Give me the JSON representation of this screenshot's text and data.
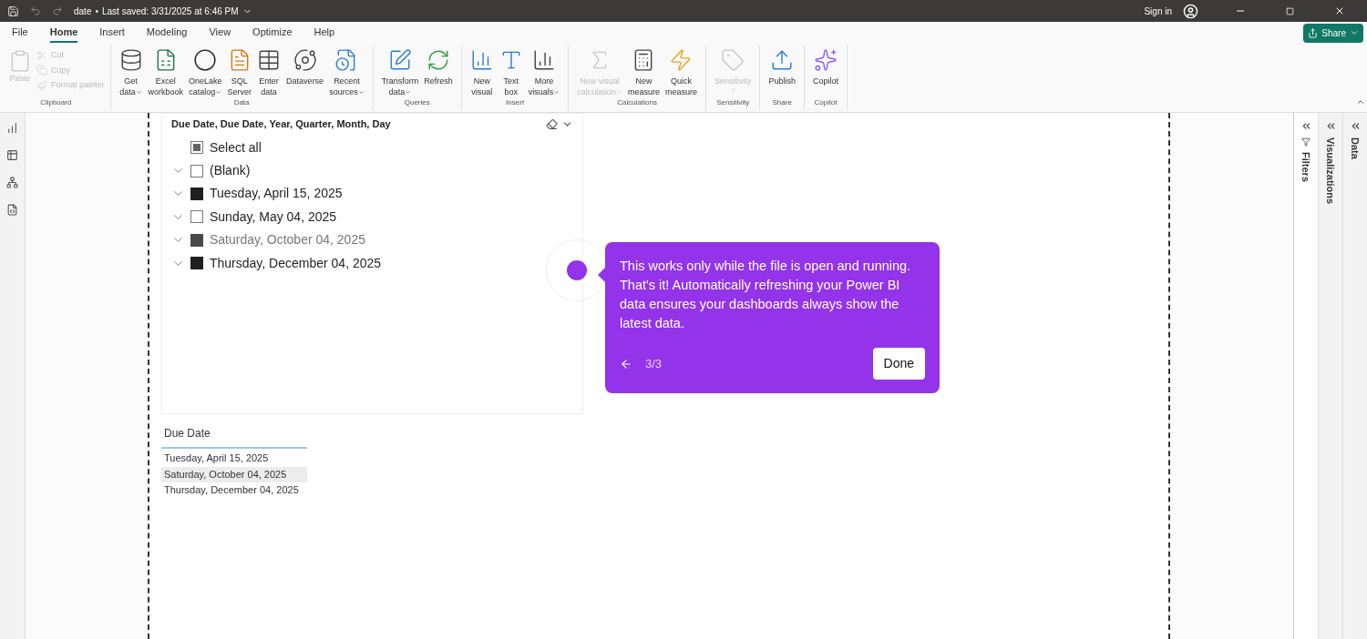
{
  "title_bar": {
    "file_name": "date",
    "separator": "•",
    "save_status": "Last saved: 3/31/2025 at 6:46 PM",
    "sign_in": "Sign in"
  },
  "menu_tabs": [
    {
      "label": "File",
      "selected": false
    },
    {
      "label": "Home",
      "selected": true
    },
    {
      "label": "Insert",
      "selected": false
    },
    {
      "label": "Modeling",
      "selected": false
    },
    {
      "label": "View",
      "selected": false
    },
    {
      "label": "Optimize",
      "selected": false
    },
    {
      "label": "Help",
      "selected": false
    }
  ],
  "share_button": "Share",
  "ribbon_groups": [
    {
      "label": "Clipboard",
      "kind": "clipboard",
      "buttons": [
        {
          "lines": [
            "Paste"
          ],
          "disabled": true
        },
        {
          "lines": [
            "Cut"
          ],
          "disabled": true
        },
        {
          "lines": [
            "Copy"
          ],
          "disabled": true
        },
        {
          "lines": [
            "Format painter"
          ],
          "disabled": true
        }
      ]
    },
    {
      "label": "Data",
      "kind": "large",
      "buttons": [
        {
          "lines": [
            "Get",
            "data"
          ],
          "disabled": false,
          "dropdown": true
        },
        {
          "lines": [
            "Excel",
            "workbook"
          ],
          "disabled": false,
          "dropdown": false
        },
        {
          "lines": [
            "OneLake",
            "catalog"
          ],
          "disabled": false,
          "dropdown": true
        },
        {
          "lines": [
            "SQL",
            "Server"
          ],
          "disabled": false,
          "dropdown": false
        },
        {
          "lines": [
            "Enter",
            "data"
          ],
          "disabled": false,
          "dropdown": false
        },
        {
          "lines": [
            "Dataverse"
          ],
          "disabled": false,
          "dropdown": false
        },
        {
          "lines": [
            "Recent",
            "sources"
          ],
          "disabled": false,
          "dropdown": true
        }
      ]
    },
    {
      "label": "Queries",
      "kind": "large",
      "buttons": [
        {
          "lines": [
            "Transform",
            "data"
          ],
          "disabled": false,
          "dropdown": true
        },
        {
          "lines": [
            "Refresh"
          ],
          "disabled": false,
          "dropdown": false
        }
      ]
    },
    {
      "label": "Insert",
      "kind": "large",
      "buttons": [
        {
          "lines": [
            "New",
            "visual"
          ],
          "disabled": false,
          "dropdown": false
        },
        {
          "lines": [
            "Text",
            "box"
          ],
          "disabled": false,
          "dropdown": false
        },
        {
          "lines": [
            "More",
            "visuals"
          ],
          "disabled": false,
          "dropdown": true
        }
      ]
    },
    {
      "label": "Calculations",
      "kind": "large",
      "buttons": [
        {
          "lines": [
            "New visual",
            "calculation"
          ],
          "disabled": true,
          "dropdown": true
        },
        {
          "lines": [
            "New",
            "measure"
          ],
          "disabled": false,
          "dropdown": false
        },
        {
          "lines": [
            "Quick",
            "measure"
          ],
          "disabled": false,
          "dropdown": false
        }
      ]
    },
    {
      "label": "Sensitivity",
      "kind": "large",
      "buttons": [
        {
          "lines": [
            "Sensitivity"
          ],
          "disabled": true,
          "dropdown": true
        }
      ]
    },
    {
      "label": "Share",
      "kind": "large",
      "buttons": [
        {
          "lines": [
            "Publish"
          ],
          "disabled": false,
          "dropdown": false
        }
      ]
    },
    {
      "label": "Copilot",
      "kind": "large",
      "buttons": [
        {
          "lines": [
            "Copilot"
          ],
          "disabled": false,
          "dropdown": false
        }
      ]
    }
  ],
  "side_panes": [
    {
      "label": "Filters",
      "selected": true
    },
    {
      "label": "Visualizations",
      "selected": false
    },
    {
      "label": "Data",
      "selected": false
    }
  ],
  "slicer": {
    "title": "Due Date, Due Date, Year, Quarter, Month, Day",
    "select_all": {
      "label": "Select all",
      "indeterminate": true
    },
    "items": [
      {
        "label": "(Blank)",
        "checked": false,
        "dimmed": false
      },
      {
        "label": "Tuesday, April 15, 2025",
        "checked": true,
        "dimmed": false
      },
      {
        "label": "Sunday, May 04, 2025",
        "checked": false,
        "dimmed": false
      },
      {
        "label": "Saturday, October 04, 2025",
        "checked": true,
        "dimmed": true
      },
      {
        "label": "Thursday, December 04, 2025",
        "checked": true,
        "dimmed": false
      }
    ]
  },
  "table": {
    "column": "Due Date",
    "rows": [
      {
        "value": "Tuesday, April 15, 2025",
        "selected": false
      },
      {
        "value": "Saturday, October 04, 2025",
        "selected": true
      },
      {
        "value": "Thursday, December 04, 2025",
        "selected": false
      }
    ]
  },
  "tour_tooltip": {
    "text": "This works only while the file is open and running. That's it! Automatically refreshing your Power BI data ensures your dashboards always show the latest data.",
    "step": "3/3",
    "done_button": "Done"
  }
}
